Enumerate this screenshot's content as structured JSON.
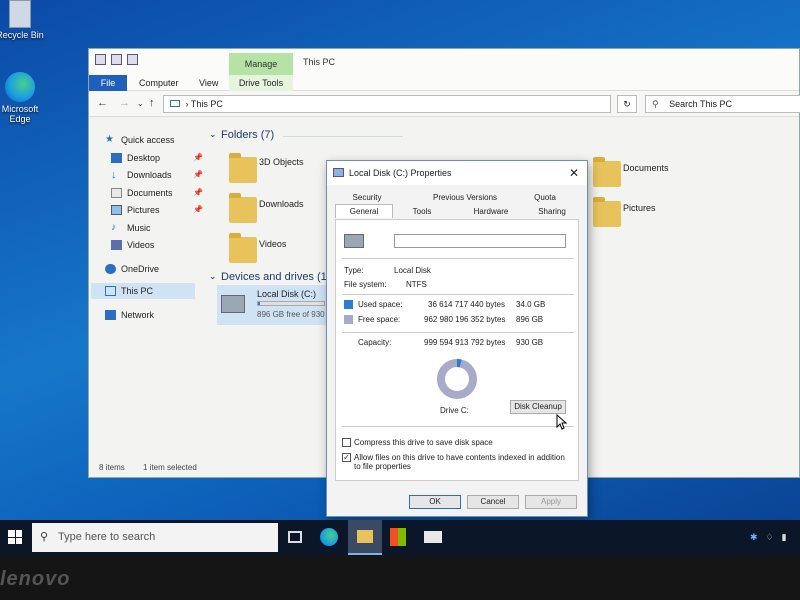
{
  "desktop": {
    "recycle_bin": "Recycle Bin",
    "edge": "Microsoft Edge"
  },
  "explorer": {
    "title": "This PC",
    "manage_tab": "Manage",
    "ribbon": {
      "file": "File",
      "computer": "Computer",
      "view": "View",
      "drive_tools": "Drive Tools"
    },
    "address": "This PC",
    "search_placeholder": "Search This PC",
    "nav": {
      "quick_access": "Quick access",
      "desktop": "Desktop",
      "downloads": "Downloads",
      "documents": "Documents",
      "pictures": "Pictures",
      "music": "Music",
      "videos": "Videos",
      "onedrive": "OneDrive",
      "this_pc": "This PC",
      "network": "Network"
    },
    "folders_header": "Folders (7)",
    "devices_header": "Devices and drives (1)",
    "folders": {
      "objects3d": "3D Objects",
      "downloads": "Downloads",
      "videos": "Videos",
      "documents": "Documents",
      "pictures": "Pictures"
    },
    "drive": {
      "name": "Local Disk (C:)",
      "free": "896 GB free of 930"
    },
    "status": {
      "items": "8 items",
      "selected": "1 item selected"
    }
  },
  "dialog": {
    "title": "Local Disk (C:) Properties",
    "tabs": {
      "security": "Security",
      "previous_versions": "Previous Versions",
      "quota": "Quota",
      "general": "General",
      "tools": "Tools",
      "hardware": "Hardware",
      "sharing": "Sharing"
    },
    "type_label": "Type:",
    "type_value": "Local Disk",
    "fs_label": "File system:",
    "fs_value": "NTFS",
    "used_label": "Used space:",
    "used_bytes": "36 614 717 440 bytes",
    "used_gb": "34.0 GB",
    "free_label": "Free space:",
    "free_bytes": "962 980 196 352 bytes",
    "free_gb": "896 GB",
    "capacity_label": "Capacity:",
    "capacity_bytes": "999 594 913 792 bytes",
    "capacity_gb": "930 GB",
    "drive_label": "Drive C:",
    "cleanup_button": "Disk Cleanup",
    "compress_label": "Compress this drive to save disk space",
    "index_label": "Allow files on this drive to have contents indexed in addition to file properties",
    "ok": "OK",
    "cancel": "Cancel",
    "apply": "Apply",
    "used_fraction": 0.037,
    "colors": {
      "used": "#2a7fd4",
      "free": "#a9a9c9"
    }
  },
  "taskbar": {
    "search_placeholder": "Type here to search"
  },
  "bezel": {
    "brand": "lenovo"
  }
}
